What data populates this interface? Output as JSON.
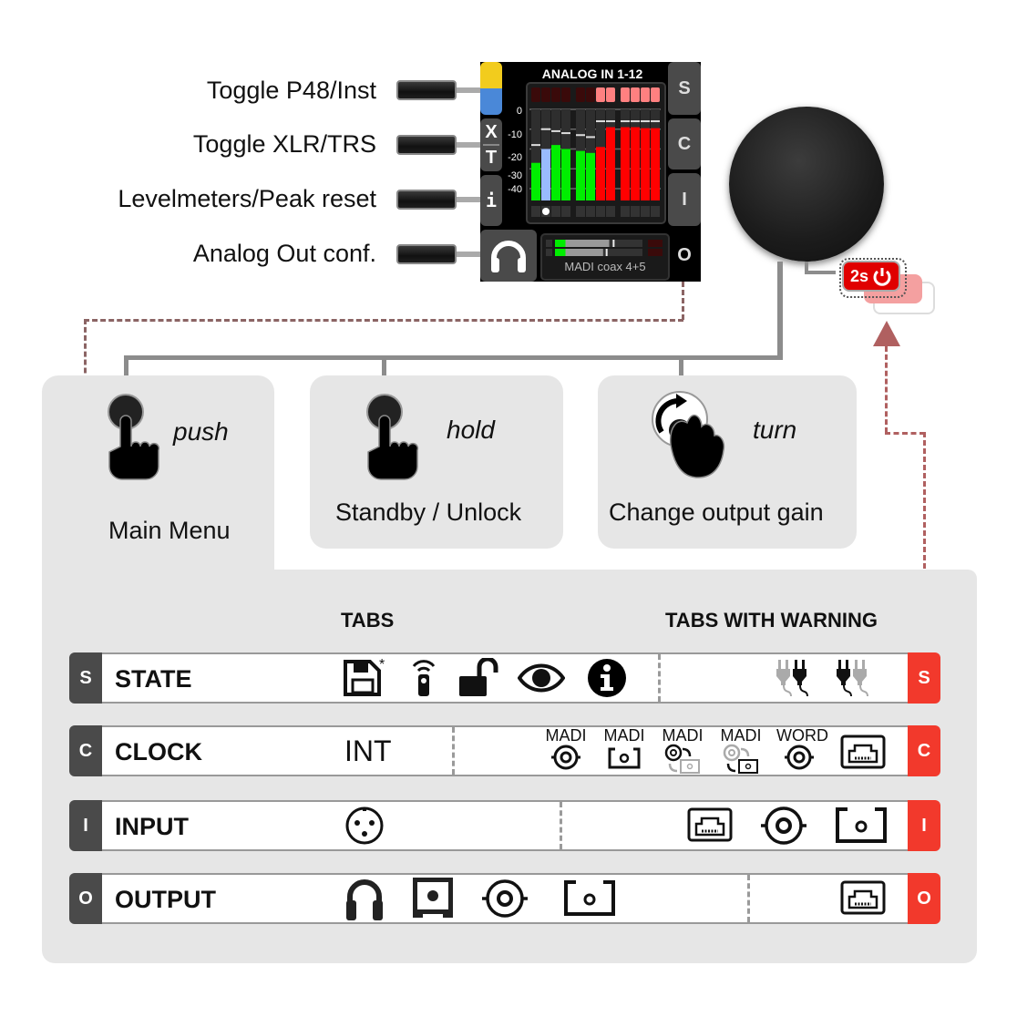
{
  "side_buttons": [
    {
      "label": "Toggle P48/Inst"
    },
    {
      "label": "Toggle XLR/TRS"
    },
    {
      "label": "Levelmeters/Peak reset"
    },
    {
      "label": "Analog Out conf."
    }
  ],
  "display": {
    "title": "ANALOG IN 1-12",
    "right_keys": [
      "S",
      "C",
      "I",
      "O"
    ],
    "left_keys": {
      "xt_top": "X",
      "xt_bottom": "T",
      "info": "i"
    },
    "db_scale": [
      "0",
      "-10",
      "-20",
      "-30",
      "-40"
    ],
    "channels": [
      {
        "level_db": -27,
        "peak_db": -18,
        "color": "green",
        "clip": false
      },
      {
        "level_db": -20,
        "peak_db": -10,
        "color": "blue",
        "clip": false,
        "selected": true
      },
      {
        "level_db": -18,
        "peak_db": -11,
        "color": "green",
        "clip": false
      },
      {
        "level_db": -20,
        "peak_db": -12,
        "color": "green",
        "clip": false
      },
      {
        "level_db": -21,
        "peak_db": -13,
        "color": "green",
        "clip": false
      },
      {
        "level_db": -22,
        "peak_db": -14,
        "color": "green",
        "clip": false
      },
      {
        "level_db": -19,
        "peak_db": -6,
        "color": "red",
        "clip": true
      },
      {
        "level_db": -9,
        "peak_db": -6,
        "color": "red",
        "clip": true
      },
      {
        "level_db": -9,
        "peak_db": -6,
        "color": "red",
        "clip": true
      },
      {
        "level_db": -9,
        "peak_db": -6,
        "color": "red",
        "clip": true
      },
      {
        "level_db": -9.5,
        "peak_db": -6,
        "color": "red",
        "clip": true
      },
      {
        "level_db": -9.5,
        "peak_db": -6,
        "color": "red",
        "clip": true
      }
    ],
    "output": {
      "label": "MADI coax 4+5",
      "levels": [
        0.12,
        0.12
      ],
      "gray_fill": [
        0.62,
        0.55
      ],
      "peaks": [
        0.66,
        0.58
      ]
    }
  },
  "power": {
    "label": "2s"
  },
  "cards": [
    {
      "verb": "push",
      "action": "Main Menu"
    },
    {
      "verb": "hold",
      "action": "Standby / Unlock"
    },
    {
      "verb": "turn",
      "action": "Change output gain"
    }
  ],
  "panel": {
    "tabs_header": "TABS",
    "warning_header": "TABS WITH WARNING",
    "rows": [
      {
        "key": "S",
        "name": "STATE",
        "tabs": [
          "save-icon",
          "remote-icon",
          "unlock-icon",
          "eye-icon",
          "info-icon"
        ],
        "warnings": [
          "power-plug-left-icon",
          "power-plug-right-icon"
        ]
      },
      {
        "key": "C",
        "name": "CLOCK",
        "tabs_text": "INT",
        "warnings": [
          {
            "label": "MADI",
            "icon": "bnc-icon"
          },
          {
            "label": "MADI",
            "icon": "optical-icon"
          },
          {
            "label": "MADI",
            "icon": "redundant-bnc-icon"
          },
          {
            "label": "MADI",
            "icon": "redundant-optical-icon"
          },
          {
            "label": "WORD",
            "icon": "bnc-icon"
          },
          {
            "label": "",
            "icon": "network-icon"
          }
        ]
      },
      {
        "key": "I",
        "name": "INPUT",
        "tabs": [
          "xlr-icon"
        ],
        "warnings": [
          "network-icon",
          "bnc-icon",
          "optical-icon"
        ]
      },
      {
        "key": "O",
        "name": "OUTPUT",
        "tabs": [
          "headphones-icon",
          "sfp-icon",
          "bnc-icon",
          "optical-icon"
        ],
        "warnings": [
          "network-icon"
        ]
      }
    ]
  },
  "colors": {
    "warning": "#f2392c",
    "meter_green": "#00ee00",
    "meter_red": "#ff0000",
    "meter_blue": "#99bbff",
    "dashed_arrow": "#8b6464"
  }
}
